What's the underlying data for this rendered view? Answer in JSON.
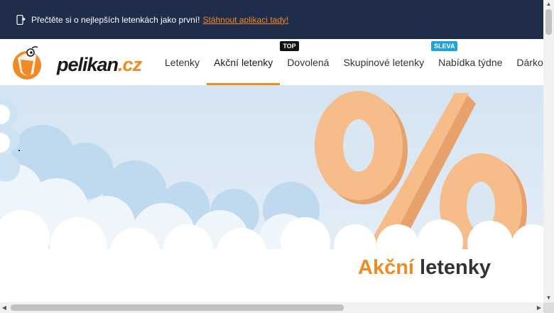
{
  "topbar": {
    "message": "Přečtěte si o nejlepších letenkách jako první!",
    "link_text": "Stáhnout aplikaci tady!"
  },
  "logo": {
    "name": "pelikan",
    "tld": ".cz"
  },
  "menu": {
    "items": [
      {
        "label": "Letenky"
      },
      {
        "label": "Akční letenky",
        "active": true
      },
      {
        "label": "Dovolená",
        "badge": "TOP"
      },
      {
        "label": "Skupinové letenky"
      },
      {
        "label": "Nabídka týdne",
        "badge": "SLEVA"
      },
      {
        "label": "Dárkove"
      }
    ]
  },
  "hero": {
    "title_highlight": "Akční",
    "title_rest": "letenky"
  },
  "colors": {
    "topbar_bg": "#1f2d4a",
    "accent": "#f08a24",
    "badge_top": "#111111",
    "badge_sleva": "#1fa3d6"
  }
}
